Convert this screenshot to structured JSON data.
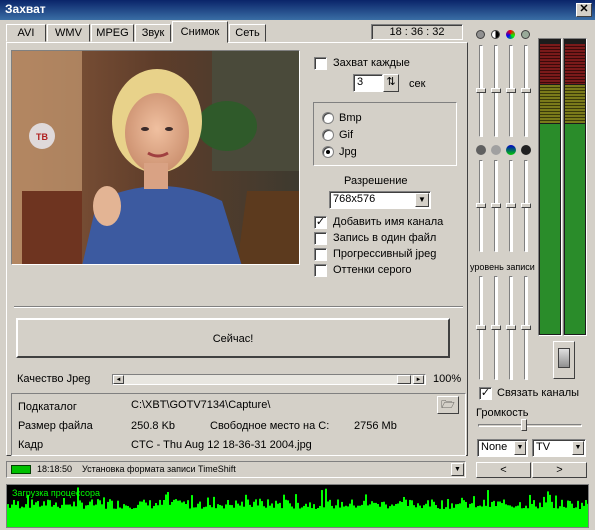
{
  "window": {
    "title": "Захват",
    "close": "✕"
  },
  "tabs": [
    {
      "label": "AVI",
      "active": false
    },
    {
      "label": "WMV",
      "active": false
    },
    {
      "label": "MPEG",
      "active": false
    },
    {
      "label": "Звук",
      "active": false
    },
    {
      "label": "Снимок",
      "active": true
    },
    {
      "label": "Сеть",
      "active": false
    }
  ],
  "clock": "18 : 36 : 32",
  "preview": {
    "logo": "ТВ"
  },
  "capture": {
    "every_label": "Захват каждые",
    "every_checked": false,
    "interval_value": "3",
    "interval_unit": "сек"
  },
  "formats": {
    "options": [
      "Bmp",
      "Gif",
      "Jpg"
    ],
    "selected": "Jpg"
  },
  "resolution": {
    "label": "Разрешение",
    "value": "768x576"
  },
  "options": [
    {
      "label": "Добавить имя канала",
      "checked": true
    },
    {
      "label": "Запись в один файл",
      "checked": false
    },
    {
      "label": "Прогрессивный jpeg",
      "checked": false
    },
    {
      "label": "Оттенки серого",
      "checked": false
    }
  ],
  "now_button": "Сейчас!",
  "quality": {
    "label": "Качество Jpeg",
    "value": "100%",
    "fraction": 1.0
  },
  "info": {
    "subdir_label": "Подкаталог",
    "subdir_value": "C:\\XBT\\GOTV7134\\Capture\\",
    "filesize_label": "Размер файла",
    "filesize_value": "250.8 Kb",
    "freespace_label": "Свободное место на C:",
    "freespace_value": "2756 Mb",
    "frame_label": "Кадр",
    "frame_value": "CTC - Thu Aug 12 18-36-31 2004.jpg"
  },
  "status": {
    "time": "18:18:50",
    "text": "Установка формата записи TimeShift"
  },
  "cpu_label": "Загрузка процессора",
  "right": {
    "record_level_label": "уровень записи",
    "link_channels_label": "Связать каналы",
    "link_channels_checked": true,
    "volume_label": "Громкость",
    "select_left": "None",
    "select_right": "TV",
    "prev": "<",
    "next": ">"
  },
  "colors": {
    "meter_green": "#2a8c2a",
    "meter_yellow": "#8c8c2a",
    "meter_red": "#8c1c1c",
    "cpu_green": "#00ff00",
    "status_led": "#00c000"
  }
}
